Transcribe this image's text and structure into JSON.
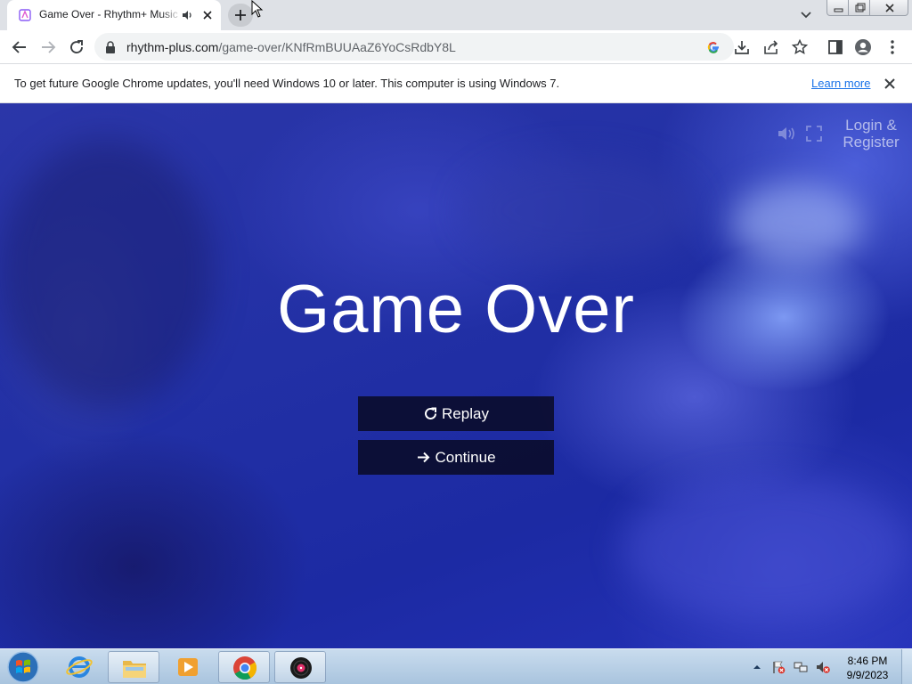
{
  "browser": {
    "tab": {
      "title": "Game Over - Rhythm+ Music Game"
    },
    "url": {
      "host": "rhythm-plus.com",
      "path": "/game-over/KNfRmBUUAaZ6YoCsRdbY8L"
    }
  },
  "infobar": {
    "message": "To get future Google Chrome updates, you'll need Windows 10 or later. This computer is using Windows 7.",
    "link": "Learn more"
  },
  "page": {
    "login_line1": "Login &",
    "login_line2": "Register",
    "title": "Game Over",
    "replay_label": "Replay",
    "continue_label": "Continue"
  },
  "taskbar": {
    "time": "8:46 PM",
    "date": "9/9/2023",
    "apps": [
      "Internet Explorer",
      "Windows Explorer",
      "Windows Media Player",
      "Google Chrome",
      "Music Player"
    ]
  },
  "colors": {
    "accent": "#1a73e8",
    "page_bg": "#2230a5",
    "button_bg": "#08081e"
  }
}
